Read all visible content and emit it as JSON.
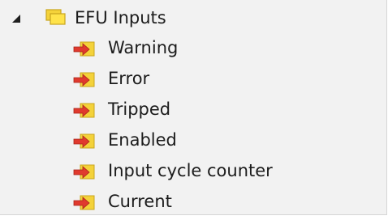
{
  "tree": {
    "root": {
      "label": "EFU Inputs",
      "expanded": true,
      "expander_icon": "triangle-expanded-icon",
      "icon": "folder-icon"
    },
    "children": [
      {
        "label": "Warning",
        "icon": "input-variable-icon"
      },
      {
        "label": "Error",
        "icon": "input-variable-icon"
      },
      {
        "label": "Tripped",
        "icon": "input-variable-icon"
      },
      {
        "label": "Enabled",
        "icon": "input-variable-icon"
      },
      {
        "label": "Input cycle counter",
        "icon": "input-variable-icon"
      },
      {
        "label": "Current",
        "icon": "input-variable-icon"
      }
    ]
  },
  "colors": {
    "panel_background": "#f2f2f2",
    "text": "#1c1c1c",
    "folder_yellow": "#f4d23a",
    "arrow_red": "#e03a2e"
  }
}
